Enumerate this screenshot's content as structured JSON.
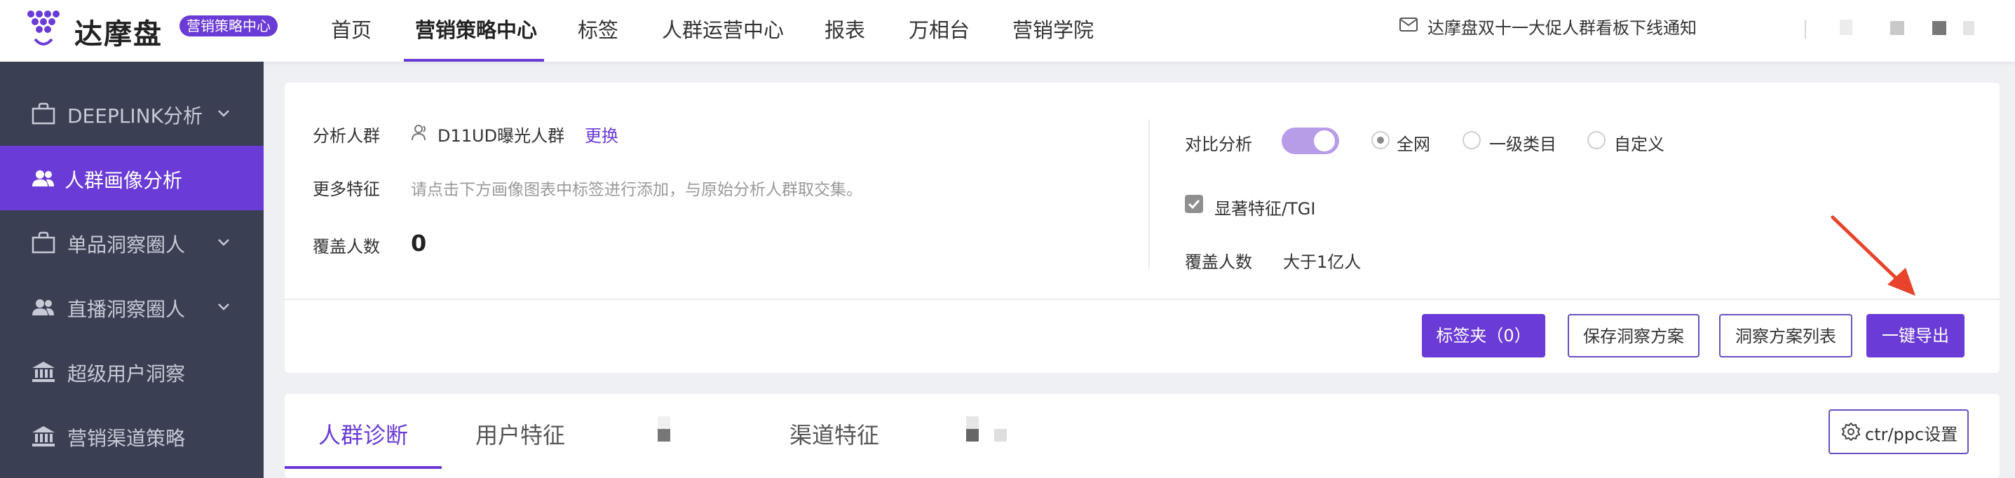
{
  "header": {
    "brand": "达摩盘",
    "badge": "营销策略中心",
    "nav": [
      "首页",
      "营销策略中心",
      "标签",
      "人群运营中心",
      "报表",
      "万相台",
      "营销学院"
    ],
    "notice": "达摩盘双十一大促人群看板下线通知"
  },
  "sidebar": {
    "items": [
      {
        "label": "DEEPLINK分析",
        "icon": "bag-icon",
        "has_chevron": true,
        "active": false
      },
      {
        "label": "人群画像分析",
        "icon": "users-icon",
        "has_chevron": false,
        "active": true
      },
      {
        "label": "单品洞察圈人",
        "icon": "bag-icon",
        "has_chevron": true,
        "active": false
      },
      {
        "label": "直播洞察圈人",
        "icon": "users-icon",
        "has_chevron": true,
        "active": false
      },
      {
        "label": "超级用户洞察",
        "icon": "bank-icon",
        "has_chevron": false,
        "active": false
      },
      {
        "label": "营销渠道策略",
        "icon": "bank-icon",
        "has_chevron": false,
        "active": false
      }
    ]
  },
  "analysis": {
    "crowd_label": "分析人群",
    "crowd_value": "D11UD曝光人群",
    "change_link": "更换",
    "more_label": "更多特征",
    "more_hint": "请点击下方画像图表中标签进行添加，与原始分析人群取交集。",
    "coverage_label": "覆盖人数",
    "coverage_value": "0"
  },
  "compare": {
    "label": "对比分析",
    "toggle_on": true,
    "options": [
      "全网",
      "一级类目",
      "自定义"
    ],
    "selected": "全网",
    "tgi_label": "显著特征/TGI",
    "tgi_checked": true,
    "coverage_label": "覆盖人数",
    "coverage_value": "大于1亿人"
  },
  "actions": {
    "tag_folder": "标签夹（0）",
    "save_plan": "保存洞察方案",
    "plan_list": "洞察方案列表",
    "export": "一键导出"
  },
  "tabs": {
    "items": [
      "人群诊断",
      "用户特征",
      "渠道特征"
    ],
    "active": "人群诊断",
    "settings_button": "ctr/ppc设置"
  },
  "colors": {
    "accent": "#6a3bd6",
    "sidebar_bg": "#3b3f54",
    "arrow": "#e8432c"
  }
}
